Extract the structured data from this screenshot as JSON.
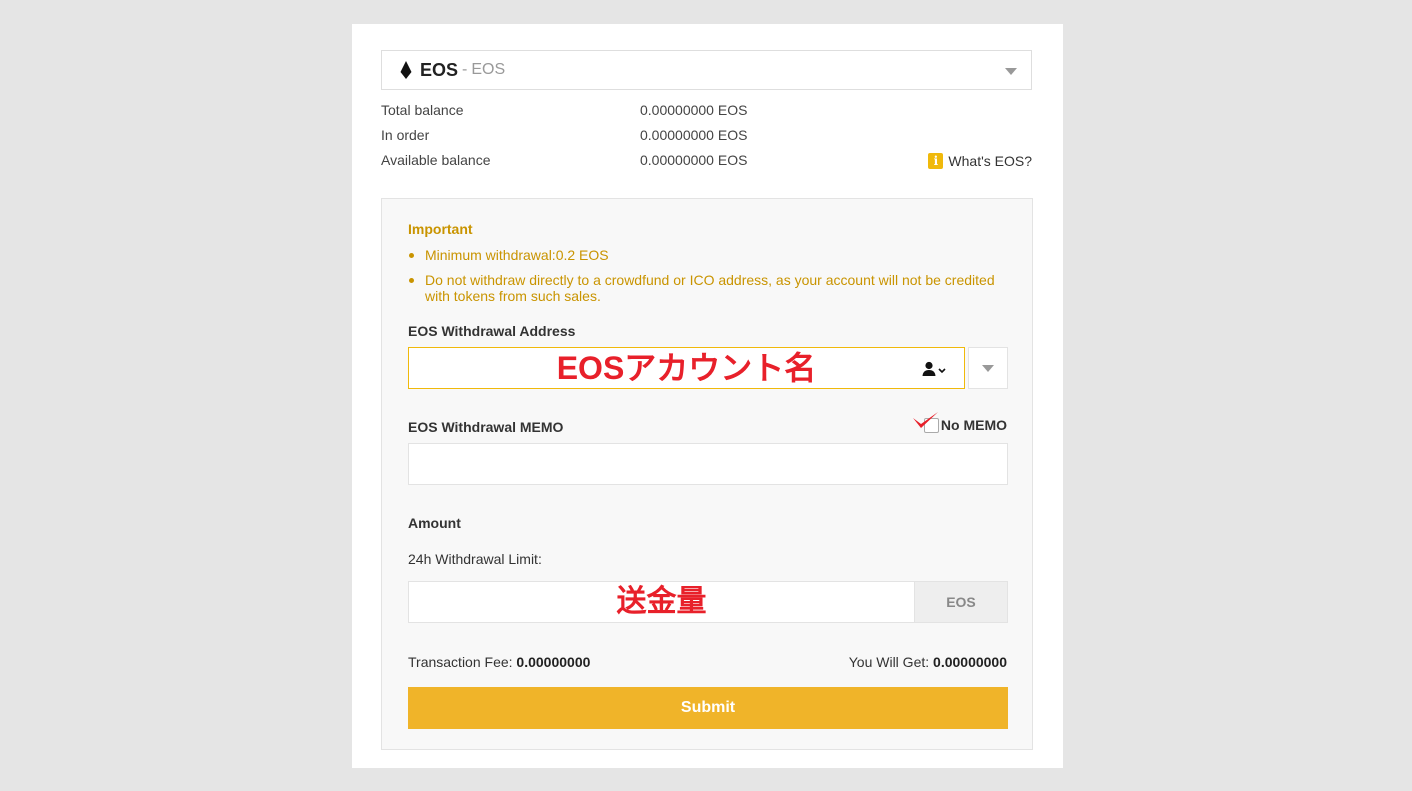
{
  "coin": {
    "symbol": "EOS",
    "separator": "-",
    "name": "EOS",
    "icon": "eos-icon"
  },
  "balances": [
    {
      "label": "Total balance",
      "value": "0.00000000 EOS"
    },
    {
      "label": "In order",
      "value": "0.00000000 EOS"
    },
    {
      "label": "Available balance",
      "value": "0.00000000 EOS"
    }
  ],
  "whats_link": "What's EOS?",
  "important": {
    "title": "Important",
    "items": [
      "Minimum withdrawal:0.2 EOS",
      "Do not withdraw directly to a crowdfund or ICO address, as your account will not be credited with tokens from such sales."
    ]
  },
  "address": {
    "label": "EOS Withdrawal Address",
    "annotation": "EOSアカウント名",
    "value": ""
  },
  "memo": {
    "label": "EOS Withdrawal MEMO",
    "no_memo_label": "No MEMO",
    "value": ""
  },
  "amount": {
    "label": "Amount",
    "limit_label": "24h Withdrawal Limit:",
    "annotation": "送金量",
    "unit": "EOS",
    "value": ""
  },
  "fee": {
    "label": "Transaction Fee:",
    "value": "0.00000000"
  },
  "get": {
    "label": "You Will Get:",
    "value": "0.00000000"
  },
  "submit_label": "Submit",
  "colors": {
    "accent": "#f0b429",
    "warning_text": "#c99400",
    "annotation": "#e8202a"
  }
}
